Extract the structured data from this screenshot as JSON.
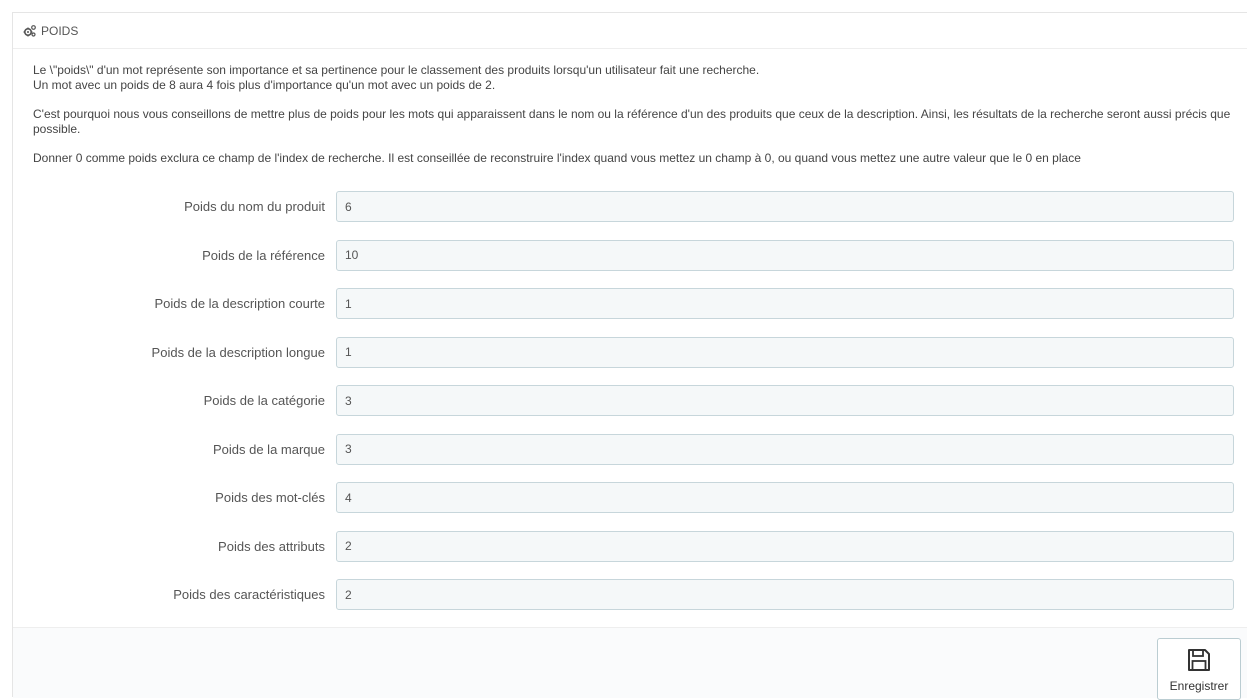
{
  "panel": {
    "title": "POIDS",
    "title_icon": "cogs-icon"
  },
  "intro": {
    "line1": "Le \\\"poids\\\" d'un mot représente son importance et sa pertinence pour le classement des produits lorsqu'un utilisateur fait une recherche.",
    "line2": "Un mot avec un poids de 8 aura 4 fois plus d'importance qu'un mot avec un poids de 2.",
    "line3": "C'est pourquoi nous vous conseillons de mettre plus de poids pour les mots qui apparaissent dans le nom ou la référence d'un des produits que ceux de la description. Ainsi, les résultats de la recherche seront aussi précis que possible.",
    "line4": "Donner 0 comme poids exclura ce champ de l'index de recherche. Il est conseillée de reconstruire l'index quand vous mettez un champ à 0, ou quand vous mettez une autre valeur que le 0 en place"
  },
  "fields": [
    {
      "label": "Poids du nom du produit",
      "value": "6"
    },
    {
      "label": "Poids de la référence",
      "value": "10"
    },
    {
      "label": "Poids de la description courte",
      "value": "1"
    },
    {
      "label": "Poids de la description longue",
      "value": "1"
    },
    {
      "label": "Poids de la catégorie",
      "value": "3"
    },
    {
      "label": "Poids de la marque",
      "value": "3"
    },
    {
      "label": "Poids des mot-clés",
      "value": "4"
    },
    {
      "label": "Poids des attributs",
      "value": "2"
    },
    {
      "label": "Poids des caractéristiques",
      "value": "2"
    }
  ],
  "footer": {
    "save_label": "Enregistrer",
    "save_icon": "floppy-disk-icon"
  }
}
